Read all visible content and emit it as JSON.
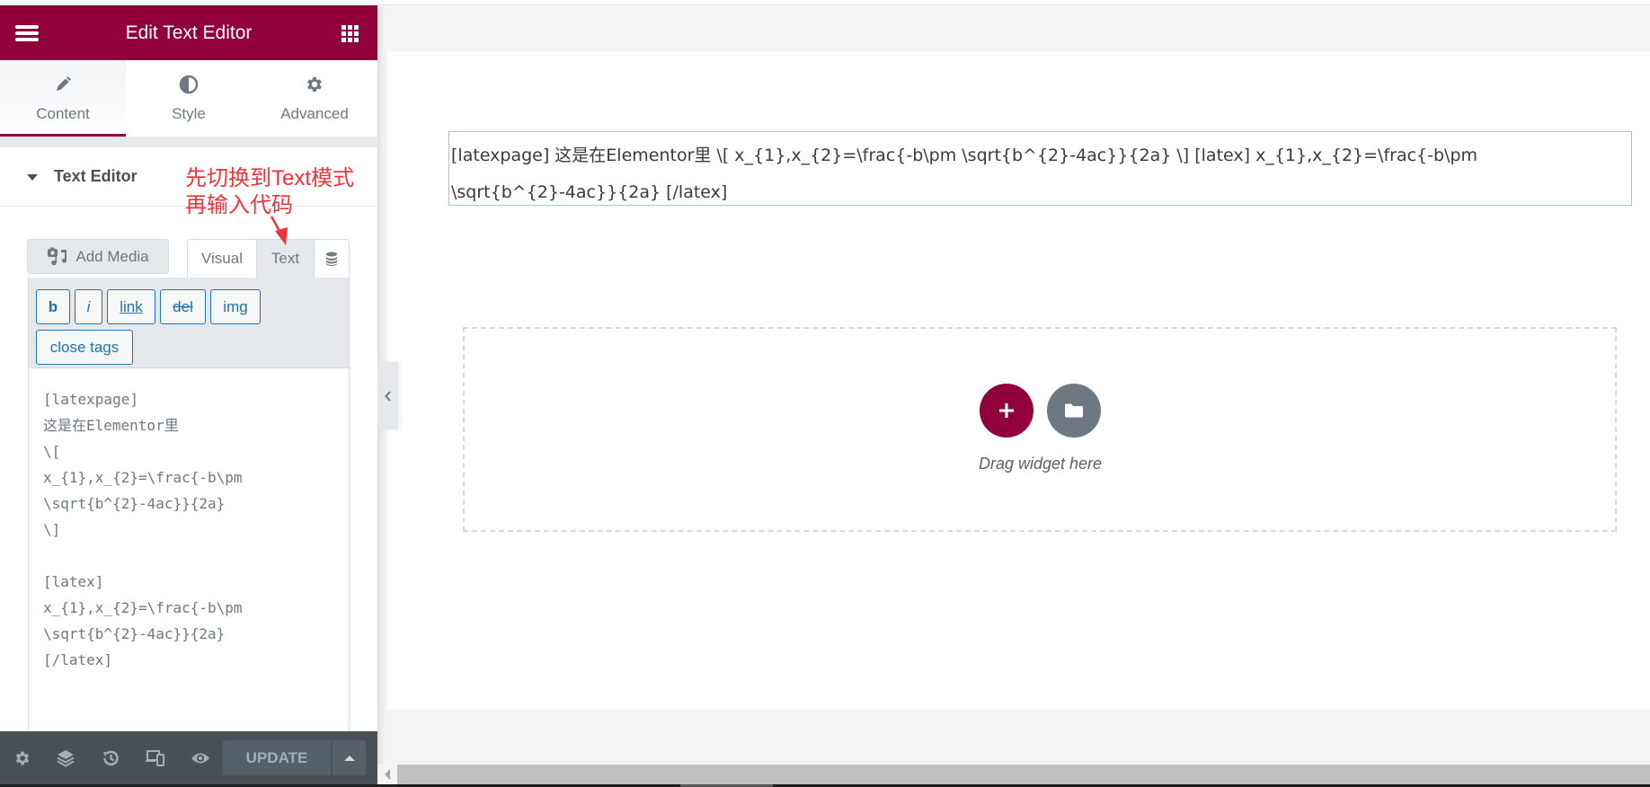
{
  "panel": {
    "title": "Edit Text Editor",
    "tabs": [
      {
        "label": "Content",
        "icon": "pencil-icon",
        "active": true
      },
      {
        "label": "Style",
        "icon": "half-circle-icon",
        "active": false
      },
      {
        "label": "Advanced",
        "icon": "gear-icon",
        "active": false
      }
    ],
    "section_title": "Text Editor",
    "annotation": "先切换到Text模式\n再输入代码",
    "add_media_label": "Add Media",
    "editor_modes": {
      "visual": "Visual",
      "text": "Text",
      "active": "Text"
    },
    "quicktags": [
      "b",
      "i",
      "link",
      "del",
      "img",
      "close tags"
    ],
    "code_content": "[latexpage]\n这是在Elementor里\n\\[\nx_{1},x_{2}=\\frac{-b\\pm\n\\sqrt{b^{2}-4ac}}{2a}\n\\]\n\n[latex]\nx_{1},x_{2}=\\frac{-b\\pm\n\\sqrt{b^{2}-4ac}}{2a}\n[/latex]",
    "footer": {
      "icons": [
        "settings-icon",
        "navigator-layers-icon",
        "history-icon",
        "responsive-mode-icon",
        "preview-eye-icon"
      ],
      "update_label": "UPDATE"
    }
  },
  "canvas": {
    "text_widget_content": "[latexpage] 这是在Elementor里 \\[ x_{1},x_{2}=\\frac{-b\\pm \\sqrt{b^{2}-4ac}}{2a} \\] [latex] x_{1},x_{2}=\\frac{-b\\pm \\sqrt{b^{2}-4ac}}{2a} [/latex]",
    "drop_zone_label": "Drag widget here"
  },
  "colors": {
    "brand": "#92003b",
    "panel_dark": "#495157",
    "widget_outline": "#71d7f7",
    "annotation": "#f2323a",
    "quicktag_blue": "#2271b1"
  }
}
